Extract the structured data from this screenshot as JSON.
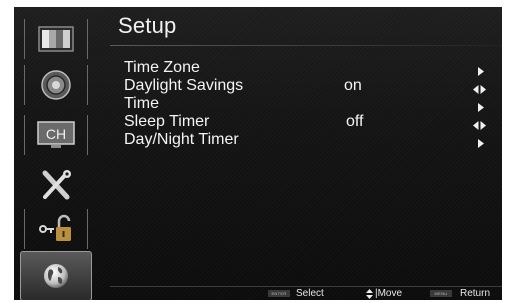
{
  "sidebar": {
    "items": [
      {
        "icon": "picture-icon"
      },
      {
        "icon": "audio-icon"
      },
      {
        "icon": "channel-icon",
        "label": "CH"
      },
      {
        "icon": "tools-icon"
      },
      {
        "icon": "lock-icon"
      },
      {
        "icon": "globe-icon"
      }
    ],
    "active_index": 5
  },
  "header": {
    "title": "Setup"
  },
  "menu": {
    "items": [
      {
        "label": "Time Zone",
        "value": "",
        "control": "arrow-right"
      },
      {
        "label": "Daylight Savings",
        "value": "on",
        "control": "arrow-left-right"
      },
      {
        "label": "Time",
        "value": "",
        "control": "arrow-right"
      },
      {
        "label": "Sleep Timer",
        "value": "off",
        "control": "arrow-left-right"
      },
      {
        "label": "Day/Night Timer",
        "value": "",
        "control": "arrow-right"
      }
    ]
  },
  "footer": {
    "select": {
      "key": "ENTER",
      "label": "Select"
    },
    "move": {
      "label": "|Move"
    },
    "return": {
      "key": "MENU",
      "label": "Return"
    }
  },
  "colors": {
    "background": "#141414",
    "text": "#f4f4f4",
    "highlight_border": "#9a9a9a"
  }
}
